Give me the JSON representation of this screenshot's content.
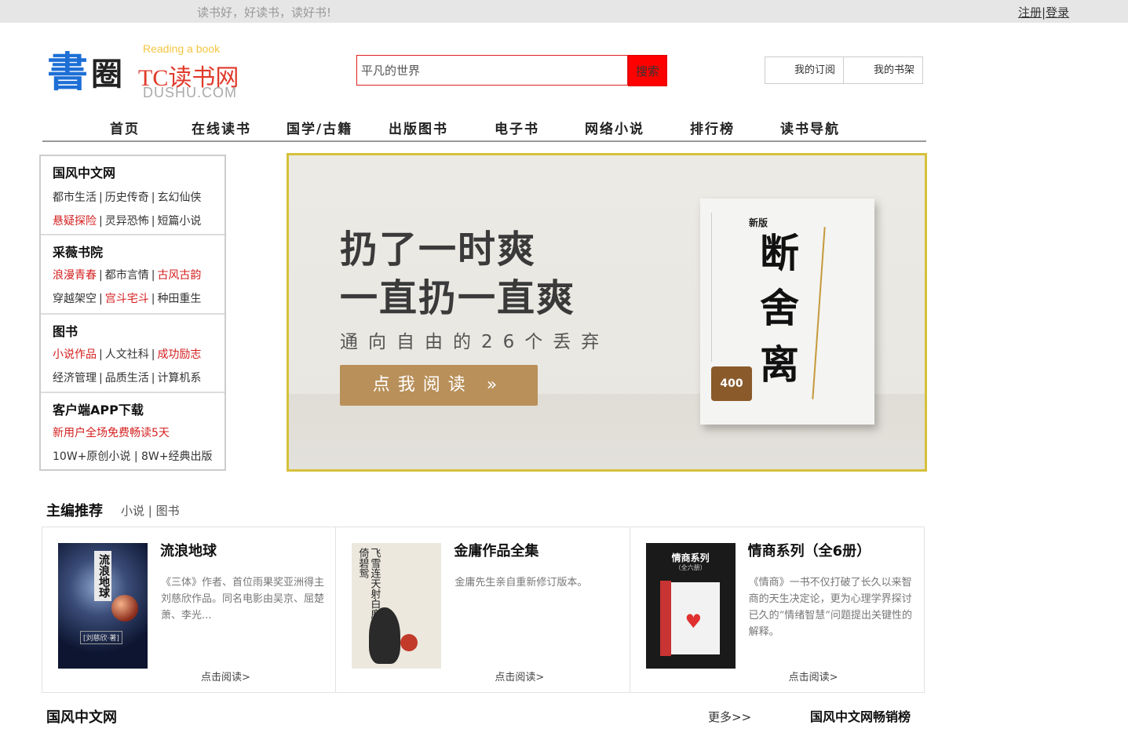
{
  "topbar": {
    "slogan": "读书好，好读书，读好书!",
    "register": "注册",
    "divider": "|",
    "login": "登录"
  },
  "logo": {
    "char1": "書",
    "char2": "圈",
    "reading": "Reading a book",
    "tc": "TC读书网",
    "dushu": "DUSHU.COM"
  },
  "search": {
    "value": "平凡的世界",
    "button": "搜索"
  },
  "user_buttons": {
    "subscribe": "我的订阅",
    "shelf": "我的书架"
  },
  "nav": [
    "首页",
    "在线读书",
    "国学/古籍",
    "出版图书",
    "电子书",
    "网络小说",
    "排行榜",
    "读书导航"
  ],
  "sidebar": {
    "sections": [
      {
        "title": "国风中文网",
        "rows": [
          [
            "都市生活",
            "历史传奇",
            "玄幻仙侠"
          ],
          [
            "悬疑探险",
            "灵异恐怖",
            "短篇小说"
          ]
        ]
      },
      {
        "title": "采薇书院",
        "rows": [
          [
            "浪漫青春",
            "都市言情",
            "古风古韵"
          ],
          [
            "穿越架空",
            "宫斗宅斗",
            "种田重生"
          ]
        ]
      },
      {
        "title": "图书",
        "rows": [
          [
            "小说作品",
            "人文社科",
            "成功励志"
          ],
          [
            "经济管理",
            "品质生活",
            "计算机系"
          ]
        ]
      },
      {
        "title": "客户端APP下载",
        "promo": "新用户全场免费畅读5天",
        "stats": "10W+原创小说 | 8W+经典出版"
      }
    ]
  },
  "banner": {
    "line1": "扔了一时爽",
    "line2": "一直扔一直爽",
    "subtitle": "通向自由的26个丢弃",
    "button": "点我阅读 »",
    "book": {
      "t1": "断",
      "t2": "舍",
      "t3": "离",
      "edition": "新版",
      "badge": "400"
    }
  },
  "recommend": {
    "heading": "主编推荐",
    "tabs": "小说 | 图书",
    "cards": [
      {
        "title": "流浪地球",
        "desc": "《三体》作者、首位雨果奖亚洲得主刘慈欣作品。同名电影由吴京、屈楚萧、李光...",
        "more": "点击阅读>",
        "cover_title": "流浪地球",
        "cover_author": "[刘慈欣·著]"
      },
      {
        "title": "金庸作品全集",
        "desc": "金庸先生亲自重新修订版本。",
        "more": "点击阅读>",
        "cover_text": "飞雪连天射白鹿笑书神侠倚碧鸳"
      },
      {
        "title": "情商系列（全6册）",
        "desc": "《情商》一书不仅打破了长久以来智商的天生决定论，更为心理学界探讨已久的“情绪智慧”问题提出关键性的解释。",
        "more": "点击阅读>",
        "cover_title": "情商系列",
        "cover_sub": "（全六册）"
      }
    ]
  },
  "bottom": {
    "title": "国风中文网",
    "more": "更多>>",
    "rank_title": "国风中文网畅销榜"
  }
}
